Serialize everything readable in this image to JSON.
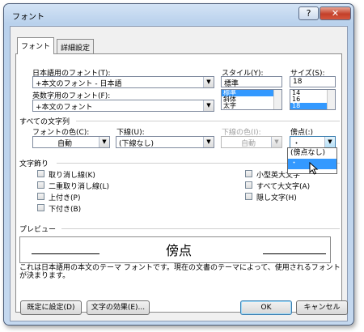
{
  "window": {
    "title": "フォント",
    "help": "?",
    "close": "✕"
  },
  "tabs": [
    {
      "label": "フォント"
    },
    {
      "label": "詳細設定"
    }
  ],
  "font": {
    "japanese_label": "日本語用のフォント(T):",
    "japanese_value": "+本文のフォント - 日本語",
    "western_label": "英数字用のフォント(F):",
    "western_value": "+本文のフォント",
    "style_label": "スタイル(Y):",
    "style_value": "標準",
    "style_options": [
      "標準",
      "斜体",
      "太字"
    ],
    "size_label": "サイズ(S):",
    "size_value": "18",
    "size_options": [
      "14",
      "16",
      "18"
    ]
  },
  "all_text": {
    "section": "すべての文字列",
    "color_label": "フォントの色(C):",
    "color_value": "自動",
    "underline_label": "下線(U):",
    "underline_value": "(下線なし)",
    "underline_color_label": "下線の色(I):",
    "underline_color_value": "自動",
    "emphasis_label": "傍点(:)",
    "emphasis_value": "・",
    "emphasis_options": [
      "(傍点なし)",
      "・"
    ]
  },
  "effects": {
    "section": "文字飾り",
    "left": [
      "取り消し線(K)",
      "二重取り消し線(L)",
      "上付き(P)",
      "下付き(B)"
    ],
    "right": [
      "小型英大文字",
      "すべて大文字(A)",
      "隠し文字(H)"
    ]
  },
  "preview": {
    "label": "プレビュー",
    "sample": "傍点",
    "description": "これは日本語用の本文のテーマ フォントです。現在の文書のテーマによって、使用されるフォントが決まります。"
  },
  "buttons": {
    "default": "既定に設定(D)",
    "text_effects": "文字の効果(E)...",
    "ok": "OK",
    "cancel": "キャンセル"
  }
}
